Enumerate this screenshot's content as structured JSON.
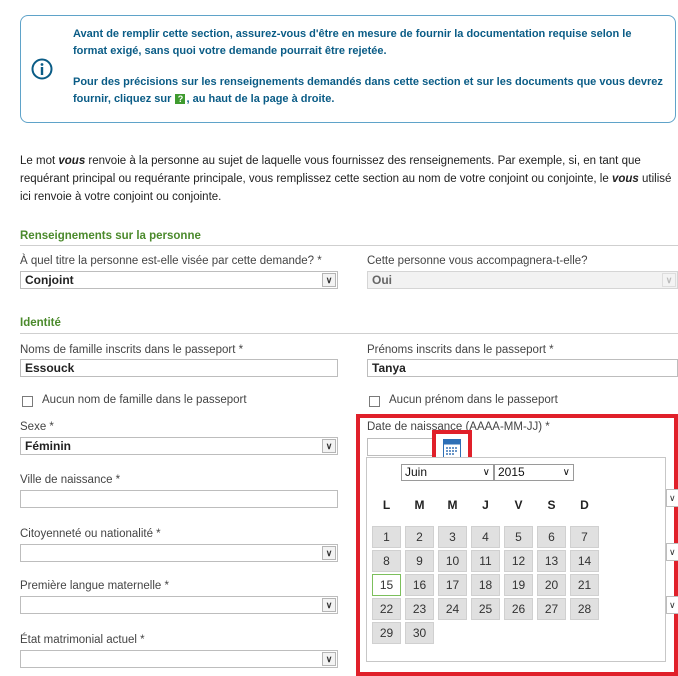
{
  "info": {
    "para1": "Avant de remplir cette section, assurez-vous d'être en mesure de fournir la documentation requise selon le format exigé, sans quoi votre demande pourrait être rejetée.",
    "para2_before": "Pour des précisions sur les renseignements demandés dans cette section et sur les documents que vous devrez fournir, cliquez sur",
    "help_glyph": "?",
    "para2_after": ", au haut de la page à droite."
  },
  "intro": {
    "part1": "Le mot",
    "vous": "vous",
    "part2": "renvoie à la personne au sujet de laquelle vous fournissez des renseignements. Par exemple, si, en tant que requérant principal ou requérante principale, vous remplissez cette section au nom de votre conjoint ou conjointe, le",
    "vous2": "vous",
    "part3": "utilisé ici renvoie à votre conjoint ou conjointe."
  },
  "sections": {
    "person": "Renseignements sur la personne",
    "identity": "Identité"
  },
  "fields": {
    "titre_label": "À quel titre la personne est-elle visée par cette demande? *",
    "titre_value": "Conjoint",
    "accompagne_label": "Cette personne vous accompagnera-t-elle?",
    "accompagne_value": "Oui",
    "nom_label": "Noms de famille inscrits dans le passeport *",
    "nom_value": "Essouck",
    "prenom_label": "Prénoms inscrits dans le passeport *",
    "prenom_value": "Tanya",
    "aucun_nom": "Aucun nom de famille dans le passeport",
    "aucun_prenom": "Aucun prénom dans le passeport",
    "sexe_label": "Sexe *",
    "sexe_value": "Féminin",
    "naissance_label": "Date de naissance (AAAA-MM-JJ) *",
    "ville_label": "Ville de naissance *",
    "citoyennete_label": "Citoyenneté ou nationalité *",
    "langue_label": "Première langue maternelle *",
    "etat_label": "État matrimonial actuel *",
    "dropdown_glyph": "∨"
  },
  "calendar": {
    "month": "Juin",
    "year": "2015",
    "weekdays": [
      "L",
      "M",
      "M",
      "J",
      "V",
      "S",
      "D"
    ],
    "days": [
      "1",
      "2",
      "3",
      "4",
      "5",
      "6",
      "7",
      "8",
      "9",
      "10",
      "11",
      "12",
      "13",
      "14",
      "15",
      "16",
      "17",
      "18",
      "19",
      "20",
      "21",
      "22",
      "23",
      "24",
      "25",
      "26",
      "27",
      "28",
      "29",
      "30"
    ],
    "today": "15"
  }
}
